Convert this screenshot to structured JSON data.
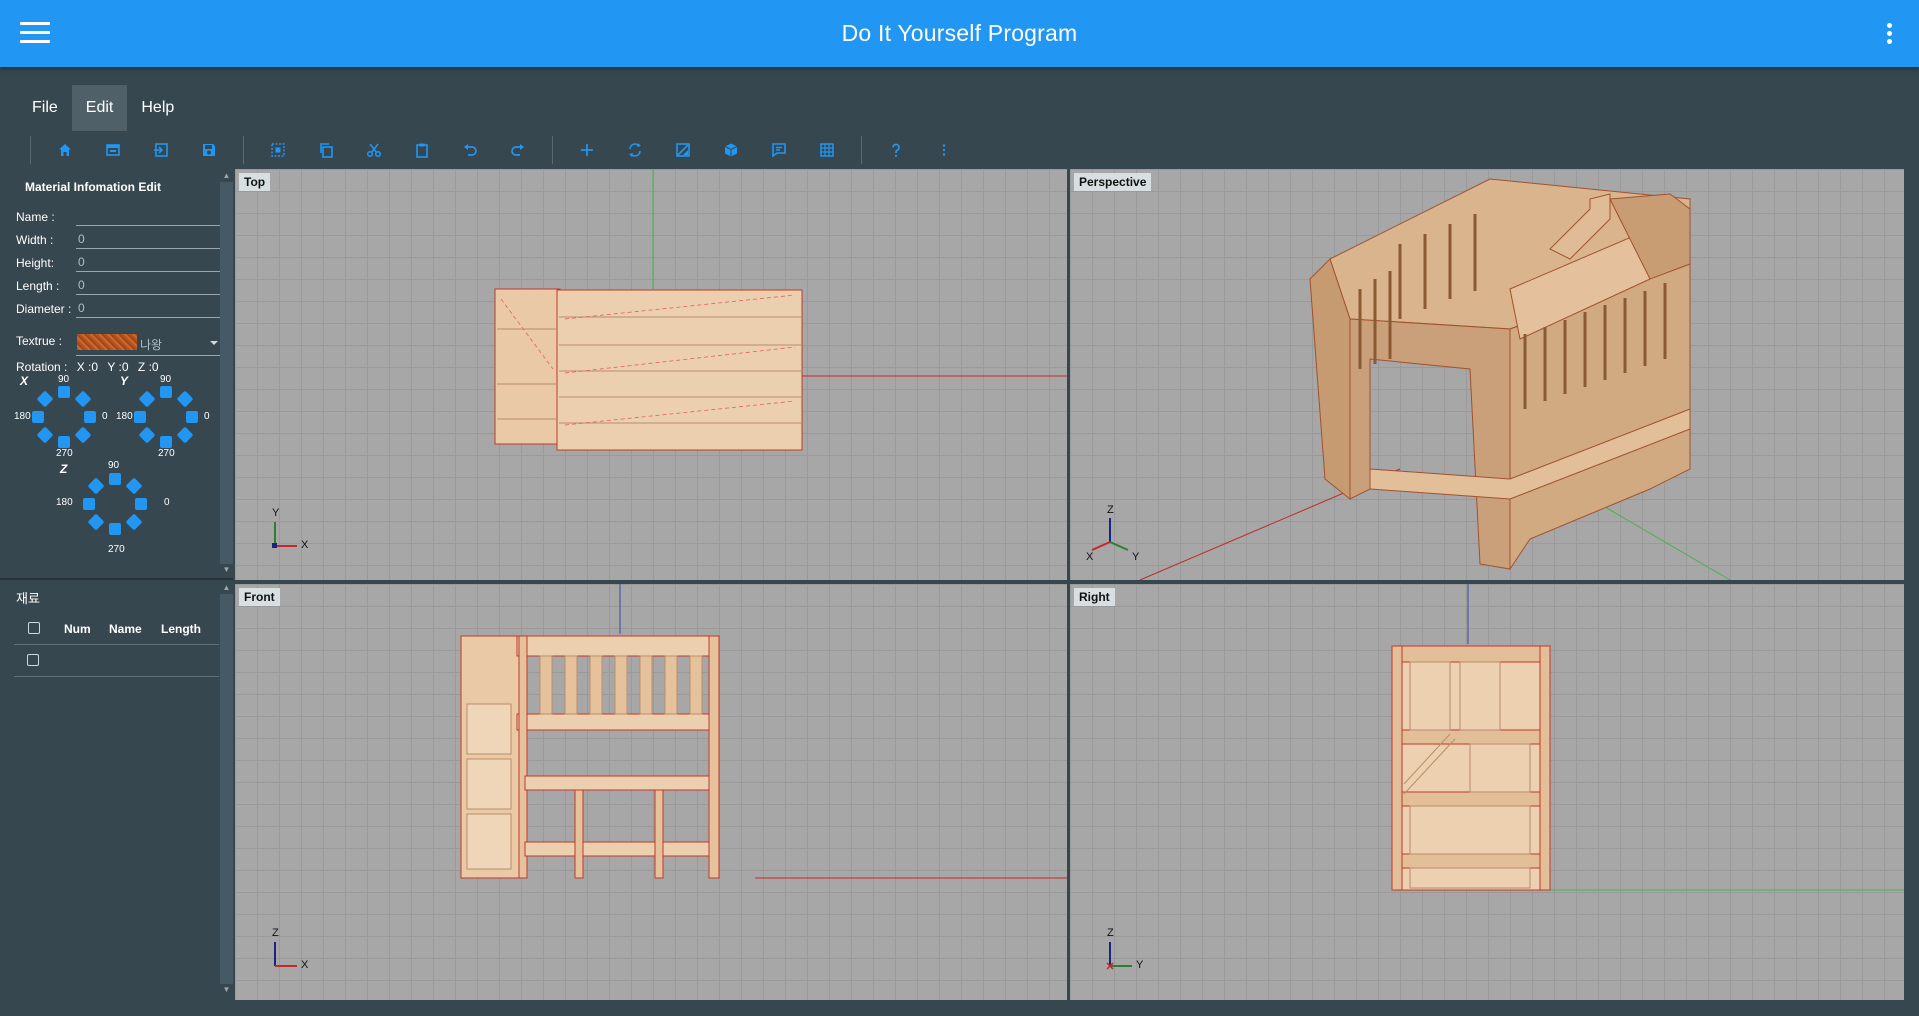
{
  "app": {
    "title": "Do It Yourself Program",
    "accent": "#2196f3"
  },
  "menu": [
    {
      "label": "File"
    },
    {
      "label": "Edit"
    },
    {
      "label": "Help"
    }
  ],
  "toolbar": {
    "icons": [
      "home-icon",
      "window-icon",
      "import-icon",
      "save-icon",
      "select-icon",
      "copy-icon",
      "cut-icon",
      "paste-icon",
      "undo-icon",
      "redo-icon",
      "add-icon",
      "rotate-icon",
      "image-icon",
      "cube-icon",
      "comment-icon",
      "grid-icon",
      "help-icon",
      "more-vert-icon"
    ]
  },
  "material_edit": {
    "title": "Material Infomation Edit",
    "name_label": "Name :",
    "name_value": "",
    "width_label": "Width :",
    "width_value": "0",
    "height_label": "Height:",
    "height_value": "0",
    "length_label": "Length :",
    "length_value": "0",
    "diameter_label": "Diameter :",
    "diameter_value": "0",
    "texture_label": "Textrue :",
    "texture_name": "나왕",
    "rotation_label": "Rotation :",
    "rotation_x": "X :0",
    "rotation_y": "Y :0",
    "rotation_z": "Z :0",
    "dial_x": {
      "axis": "X",
      "top": "90",
      "left": "180",
      "right": "0",
      "bottom": "270"
    },
    "dial_y": {
      "axis": "Y",
      "top": "90",
      "left": "180",
      "right": "0",
      "bottom": "270"
    },
    "dial_z": {
      "axis": "Z",
      "top": "90",
      "left": "180",
      "right": "0",
      "bottom": "270"
    }
  },
  "materials": {
    "title": "재료",
    "columns": [
      "Num",
      "Name",
      "Length"
    ],
    "rows": []
  },
  "viewports": {
    "top": {
      "label": "Top",
      "axis_a": "Y",
      "axis_b": "X"
    },
    "perspective": {
      "label": "Perspective",
      "axis_a": "Z",
      "axis_b": "X",
      "axis_c": "Y"
    },
    "front": {
      "label": "Front",
      "axis_a": "Z",
      "axis_b": "X"
    },
    "right": {
      "label": "Right",
      "axis_a": "Z",
      "axis_b": "Y"
    }
  }
}
